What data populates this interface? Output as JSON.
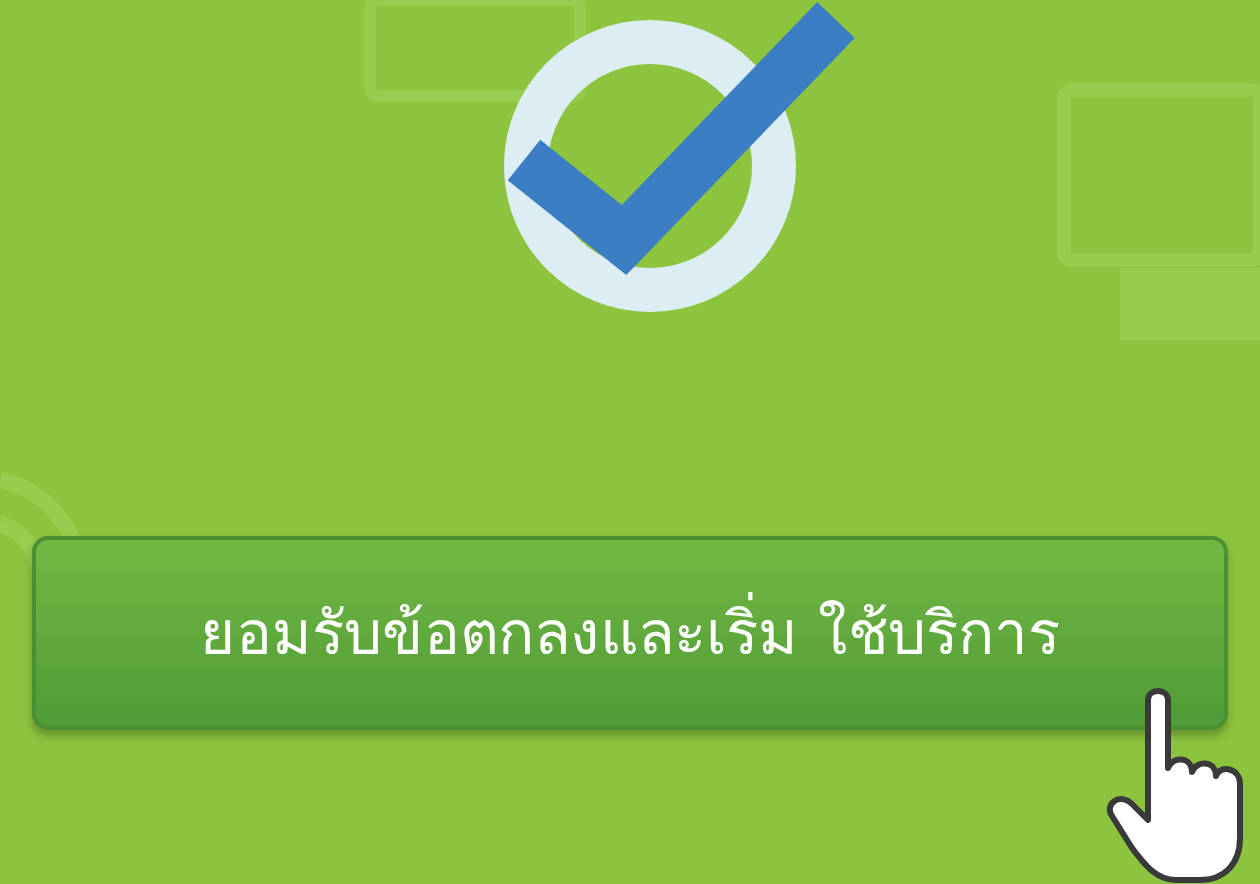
{
  "button": {
    "label": "ยอมรับข้อตกลงและเริ่ม ใช้บริการ"
  }
}
